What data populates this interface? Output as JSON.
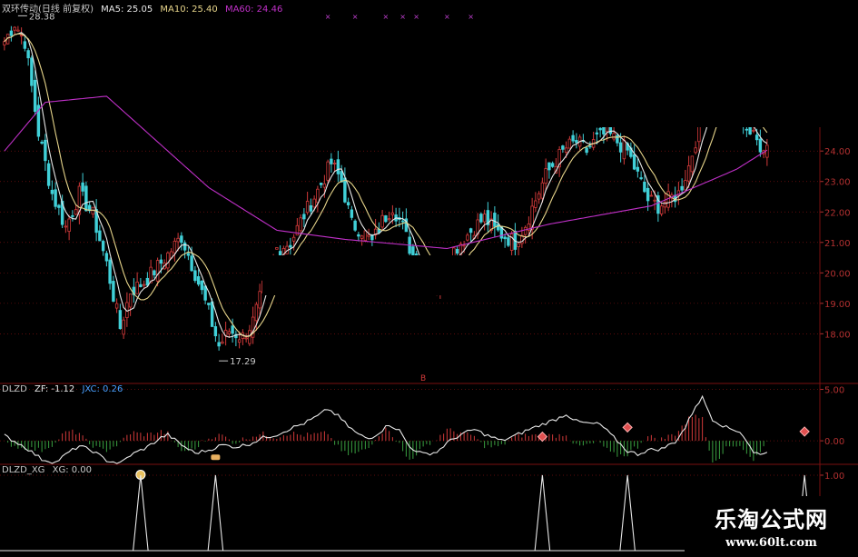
{
  "colors": {
    "up": "#d23a3a",
    "down": "#40d0d8",
    "ma5": "#e8e8e8",
    "ma10": "#e6d48a",
    "ma60": "#c030c8",
    "grid": "#7a1010",
    "axis_text": "#b23030",
    "zf": "#e8e8e8",
    "hist_up": "#d23a3a",
    "hist_down": "#3aa040",
    "xg": "#e8e8e8",
    "sep": "#7a1010"
  },
  "header_main": {
    "title": "双环传动(日线 前复权)",
    "ma5_label": "MA5: 25.05",
    "ma10_label": "MA10: 25.40",
    "ma60_label": "MA60: 24.46"
  },
  "header_dlzd": {
    "title": "DLZD",
    "zf_label": "ZF: -1.12",
    "jxc_label": "JXC: 0.26"
  },
  "header_xg": {
    "title": "DLZD_XG",
    "xg_label": "XG: 0.00"
  },
  "watermark": {
    "line1": "乐淘公式网",
    "line2": "www.60lt.com"
  },
  "chart_data": [
    {
      "type": "candlestick",
      "title": "双环传动(日线 前复权)",
      "ylim": [
        16.4,
        28.6
      ],
      "y_ticks": [
        "24.00",
        "23.00",
        "22.00",
        "21.00",
        "20.00",
        "19.00",
        "18.00"
      ],
      "annotations": [
        {
          "text": "28.38",
          "bar": 4,
          "price": 28.38
        },
        {
          "text": "17.29",
          "bar": 63,
          "price": 17.29
        }
      ],
      "anchors": [
        [
          0,
          27.6
        ],
        [
          3,
          28.2
        ],
        [
          6,
          27.6
        ],
        [
          10,
          24.6
        ],
        [
          14,
          22.6
        ],
        [
          18,
          21.5
        ],
        [
          22,
          22.6
        ],
        [
          26,
          21.9
        ],
        [
          30,
          20.3
        ],
        [
          34,
          18.2
        ],
        [
          37,
          19.4
        ],
        [
          41,
          19.7
        ],
        [
          45,
          20.2
        ],
        [
          48,
          20.6
        ],
        [
          52,
          21.2
        ],
        [
          56,
          20.0
        ],
        [
          60,
          18.7
        ],
        [
          63,
          17.6
        ],
        [
          66,
          18.1
        ],
        [
          70,
          17.9
        ],
        [
          73,
          18.4
        ],
        [
          76,
          19.5
        ],
        [
          80,
          20.8
        ],
        [
          84,
          21.0
        ],
        [
          88,
          21.9
        ],
        [
          92,
          22.7
        ],
        [
          96,
          23.6
        ],
        [
          99,
          23.0
        ],
        [
          102,
          21.6
        ],
        [
          105,
          21.4
        ],
        [
          108,
          21.0
        ],
        [
          111,
          21.7
        ],
        [
          114,
          22.2
        ],
        [
          117,
          21.5
        ],
        [
          120,
          20.5
        ],
        [
          124,
          20.0
        ],
        [
          127,
          19.7
        ],
        [
          130,
          20.5
        ],
        [
          134,
          21.0
        ],
        [
          138,
          21.5
        ],
        [
          141,
          21.8
        ],
        [
          144,
          21.4
        ],
        [
          147,
          21.2
        ],
        [
          150,
          21.0
        ],
        [
          153,
          21.6
        ],
        [
          156,
          22.4
        ],
        [
          159,
          23.2
        ],
        [
          162,
          23.7
        ],
        [
          165,
          24.1
        ],
        [
          168,
          24.3
        ],
        [
          171,
          24.0
        ],
        [
          174,
          24.4
        ],
        [
          177,
          24.6
        ],
        [
          180,
          24.3
        ],
        [
          183,
          24.0
        ],
        [
          186,
          23.2
        ],
        [
          189,
          22.4
        ],
        [
          192,
          22.2
        ],
        [
          195,
          22.4
        ],
        [
          198,
          22.6
        ],
        [
          201,
          23.5
        ],
        [
          204,
          24.8
        ],
        [
          207,
          25.8
        ],
        [
          210,
          26.2
        ],
        [
          213,
          25.8
        ],
        [
          216,
          25.2
        ],
        [
          219,
          24.6
        ],
        [
          222,
          24.2
        ]
      ],
      "series": [
        {
          "name": "MA5",
          "values": []
        },
        {
          "name": "MA10",
          "values": []
        },
        {
          "name": "MA60",
          "values": []
        }
      ]
    },
    {
      "type": "bar",
      "title": "DLZD",
      "ylim": [
        -2.2,
        5.4
      ],
      "y_ticks": [
        "5.00",
        "0.00"
      ],
      "zf_anchors": [
        [
          0,
          0.5
        ],
        [
          6,
          -0.6
        ],
        [
          11,
          -1.8
        ],
        [
          15,
          -2.1
        ],
        [
          19,
          -1.1
        ],
        [
          22,
          -0.5
        ],
        [
          26,
          -1.0
        ],
        [
          30,
          -1.9
        ],
        [
          34,
          -2.2
        ],
        [
          37,
          -1.4
        ],
        [
          42,
          -0.6
        ],
        [
          46,
          0.3
        ],
        [
          48,
          0.6
        ],
        [
          52,
          -0.4
        ],
        [
          56,
          -1.2
        ],
        [
          60,
          -0.9
        ],
        [
          64,
          -0.4
        ],
        [
          68,
          -0.6
        ],
        [
          72,
          -0.3
        ],
        [
          76,
          0.3
        ],
        [
          80,
          0.6
        ],
        [
          84,
          1.2
        ],
        [
          88,
          1.7
        ],
        [
          92,
          2.4
        ],
        [
          95,
          3.1
        ],
        [
          98,
          2.4
        ],
        [
          101,
          1.4
        ],
        [
          104,
          0.6
        ],
        [
          107,
          0.2
        ],
        [
          110,
          0.8
        ],
        [
          113,
          1.6
        ],
        [
          116,
          1.0
        ],
        [
          119,
          -0.6
        ],
        [
          123,
          -1.3
        ],
        [
          127,
          -1.1
        ],
        [
          130,
          -0.2
        ],
        [
          134,
          0.6
        ],
        [
          138,
          1.1
        ],
        [
          142,
          0.5
        ],
        [
          146,
          0.0
        ],
        [
          150,
          0.5
        ],
        [
          154,
          1.1
        ],
        [
          158,
          1.6
        ],
        [
          162,
          2.1
        ],
        [
          165,
          2.6
        ],
        [
          168,
          1.9
        ],
        [
          171,
          1.7
        ],
        [
          175,
          1.6
        ],
        [
          179,
          0.3
        ],
        [
          183,
          -1.0
        ],
        [
          186,
          -1.3
        ],
        [
          189,
          -0.9
        ],
        [
          193,
          -0.8
        ],
        [
          197,
          -0.1
        ],
        [
          200,
          1.3
        ],
        [
          203,
          3.4
        ],
        [
          205,
          4.2
        ],
        [
          208,
          2.1
        ],
        [
          212,
          1.3
        ],
        [
          216,
          0.9
        ],
        [
          218,
          0.0
        ],
        [
          220,
          -1.2
        ],
        [
          222,
          -1.2
        ]
      ],
      "markers": [
        {
          "bar": 40,
          "symbol": "money-bag",
          "value": -3.3
        },
        {
          "bar": 62,
          "symbol": "hand",
          "value": -1.6
        },
        {
          "bar": 158,
          "symbol": "diamond",
          "value": 0.4
        },
        {
          "bar": 183,
          "symbol": "diamond",
          "value": 1.3
        },
        {
          "bar": 235,
          "symbol": "diamond",
          "value": 0.9
        }
      ]
    },
    {
      "type": "line",
      "title": "DLZD_XG",
      "ylim": [
        0,
        1.12
      ],
      "y_ticks": [
        "1.00"
      ],
      "spikes": [
        40,
        62,
        158,
        183,
        235
      ],
      "values": []
    }
  ]
}
